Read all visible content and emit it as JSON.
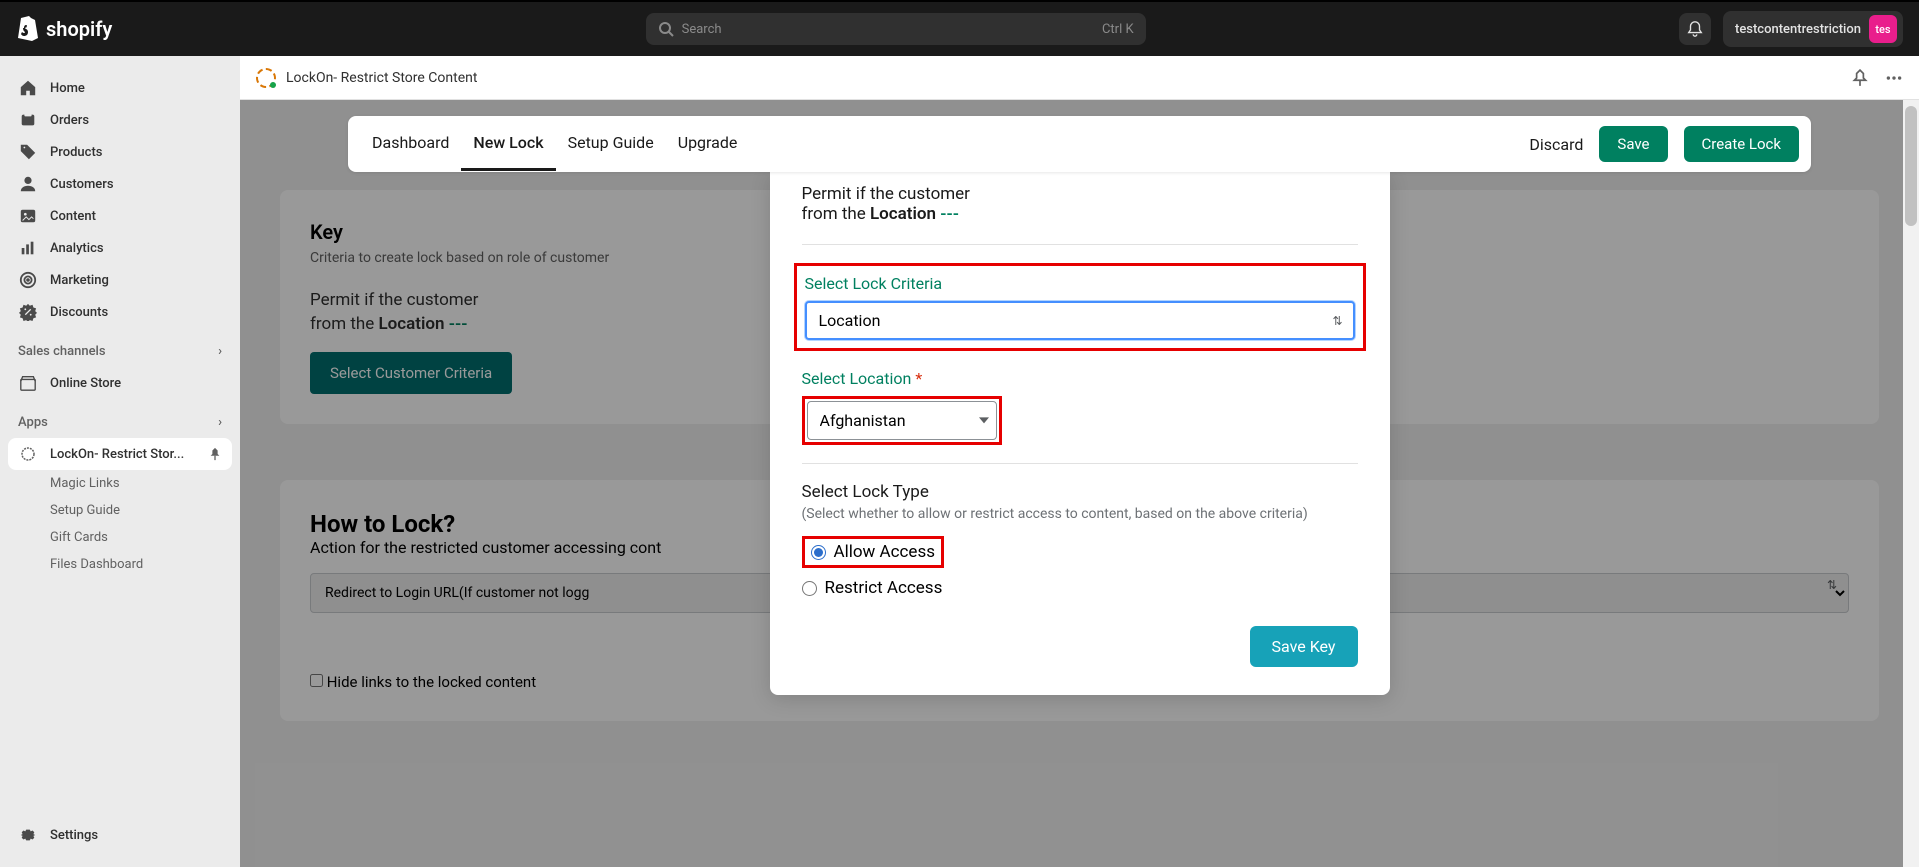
{
  "topbar": {
    "logo_text": "shopify",
    "search_placeholder": "Search",
    "search_shortcut": "Ctrl K",
    "store_name": "testcontentrestriction",
    "avatar_initials": "tes"
  },
  "sidebar": {
    "items": [
      {
        "label": "Home",
        "icon": "home"
      },
      {
        "label": "Orders",
        "icon": "orders"
      },
      {
        "label": "Products",
        "icon": "products"
      },
      {
        "label": "Customers",
        "icon": "customers"
      },
      {
        "label": "Content",
        "icon": "content"
      },
      {
        "label": "Analytics",
        "icon": "analytics"
      },
      {
        "label": "Marketing",
        "icon": "marketing"
      },
      {
        "label": "Discounts",
        "icon": "discounts"
      }
    ],
    "sales_channels_label": "Sales channels",
    "online_store_label": "Online Store",
    "apps_label": "Apps",
    "app_item": "LockOn- Restrict Stor...",
    "app_sub": [
      "Magic Links",
      "Setup Guide",
      "Gift Cards",
      "Files Dashboard"
    ],
    "settings_label": "Settings"
  },
  "app_header": {
    "title": "LockOn- Restrict Store Content"
  },
  "tabs": {
    "items": [
      "Dashboard",
      "New Lock",
      "Setup Guide",
      "Upgrade"
    ],
    "active": "New Lock",
    "discard": "Discard",
    "save": "Save",
    "create": "Create Lock"
  },
  "bg": {
    "key_title": "Key",
    "key_sub": "Criteria to create lock based on role of customer",
    "permit1": "Permit if the customer",
    "permit2_a": "from the ",
    "permit2_b": "Location",
    "permit2_c": " ---",
    "select_btn": "Select Customer Criteria",
    "how_title": "How to Lock?",
    "how_sub": "Action for the restricted customer accessing cont",
    "how_select": "Redirect to Login URL(If customer not logg",
    "hide_check": "Hide links to the locked content"
  },
  "modal": {
    "desc1": "Permit if the customer",
    "desc2_a": "from the ",
    "desc2_b": "Location",
    "desc2_c": " ---",
    "criteria_label": "Select Lock Criteria",
    "criteria_value": "Location",
    "location_label": "Select Location ",
    "location_req": "*",
    "location_value": "Afghanistan",
    "locktype_label": "Select Lock Type",
    "locktype_sub": "(Select whether to allow or restrict access to content, based on the above criteria)",
    "allow_label": "Allow Access",
    "restrict_label": "Restrict Access",
    "savekey": "Save Key"
  }
}
